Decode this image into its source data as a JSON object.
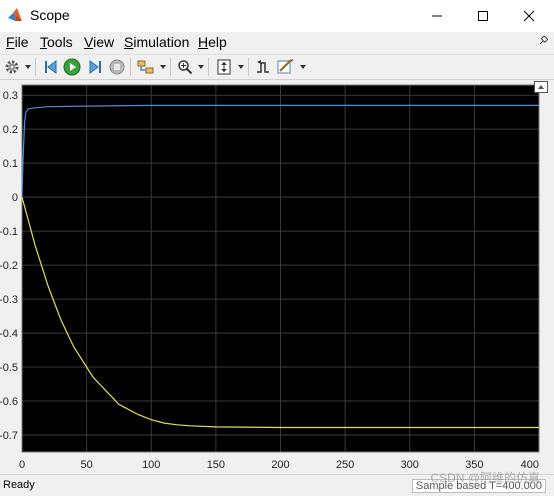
{
  "window": {
    "title": "Scope",
    "controls": {
      "minimize": "—",
      "maximize": "☐",
      "close": "✕"
    }
  },
  "menu": {
    "items": [
      {
        "label": "File",
        "underline": "F",
        "rest": "ile"
      },
      {
        "label": "Tools",
        "underline": "T",
        "rest": "ools"
      },
      {
        "label": "View",
        "underline": "V",
        "rest": "iew"
      },
      {
        "label": "Simulation",
        "underline": "S",
        "rest": "imulation"
      },
      {
        "label": "Help",
        "underline": "H",
        "rest": "elp"
      }
    ]
  },
  "toolbar": {
    "buttons": [
      "settings-icon",
      "step-back-icon",
      "run-icon",
      "step-forward-icon",
      "stop-icon",
      "highlight-icon",
      "zoom-icon",
      "autoscale-icon",
      "triggers-icon",
      "cursor-measure-icon"
    ]
  },
  "chart_data": {
    "type": "line",
    "xlim": [
      0,
      400
    ],
    "ylim": [
      -0.75,
      0.33
    ],
    "x_ticks": [
      0,
      50,
      100,
      150,
      200,
      250,
      300,
      350,
      400
    ],
    "x_tick_labels": [
      "0",
      "50",
      "100",
      "150",
      "200",
      "250",
      "300",
      "350",
      "400"
    ],
    "y_ticks": [
      0.3,
      0.2,
      0.1,
      0,
      -0.1,
      -0.2,
      -0.3,
      -0.4,
      -0.5,
      -0.6,
      -0.7
    ],
    "y_tick_labels": [
      "0.3",
      "0.2",
      "0.1",
      "0",
      "-0.1",
      "-0.2",
      "-0.3",
      "-0.4",
      "-0.5",
      "-0.6",
      "-0.7"
    ],
    "grid": true,
    "background": "#000000",
    "grid_color": "#3a3a3a",
    "series": [
      {
        "color": "#4a8fd8",
        "points": [
          [
            0,
            0
          ],
          [
            1,
            0.13
          ],
          [
            2,
            0.22
          ],
          [
            3,
            0.25
          ],
          [
            5,
            0.26
          ],
          [
            10,
            0.263
          ],
          [
            20,
            0.266
          ],
          [
            50,
            0.268
          ],
          [
            100,
            0.27
          ],
          [
            400,
            0.27
          ]
        ]
      },
      {
        "color": "#e0e050",
        "points": [
          [
            0,
            0
          ],
          [
            5,
            -0.07
          ],
          [
            10,
            -0.14
          ],
          [
            15,
            -0.2
          ],
          [
            20,
            -0.26
          ],
          [
            25,
            -0.31
          ],
          [
            30,
            -0.36
          ],
          [
            35,
            -0.4
          ],
          [
            40,
            -0.44
          ],
          [
            45,
            -0.47
          ],
          [
            50,
            -0.5
          ],
          [
            55,
            -0.53
          ],
          [
            60,
            -0.55
          ],
          [
            65,
            -0.57
          ],
          [
            70,
            -0.59
          ],
          [
            75,
            -0.61
          ],
          [
            80,
            -0.62
          ],
          [
            90,
            -0.64
          ],
          [
            100,
            -0.655
          ],
          [
            110,
            -0.665
          ],
          [
            120,
            -0.67
          ],
          [
            130,
            -0.673
          ],
          [
            150,
            -0.676
          ],
          [
            200,
            -0.678
          ],
          [
            300,
            -0.678
          ],
          [
            400,
            -0.678
          ]
        ]
      }
    ]
  },
  "status": {
    "left": "Ready",
    "right": "Sample based   T=400.000"
  },
  "watermark": "CSDN @阿维的仿真"
}
